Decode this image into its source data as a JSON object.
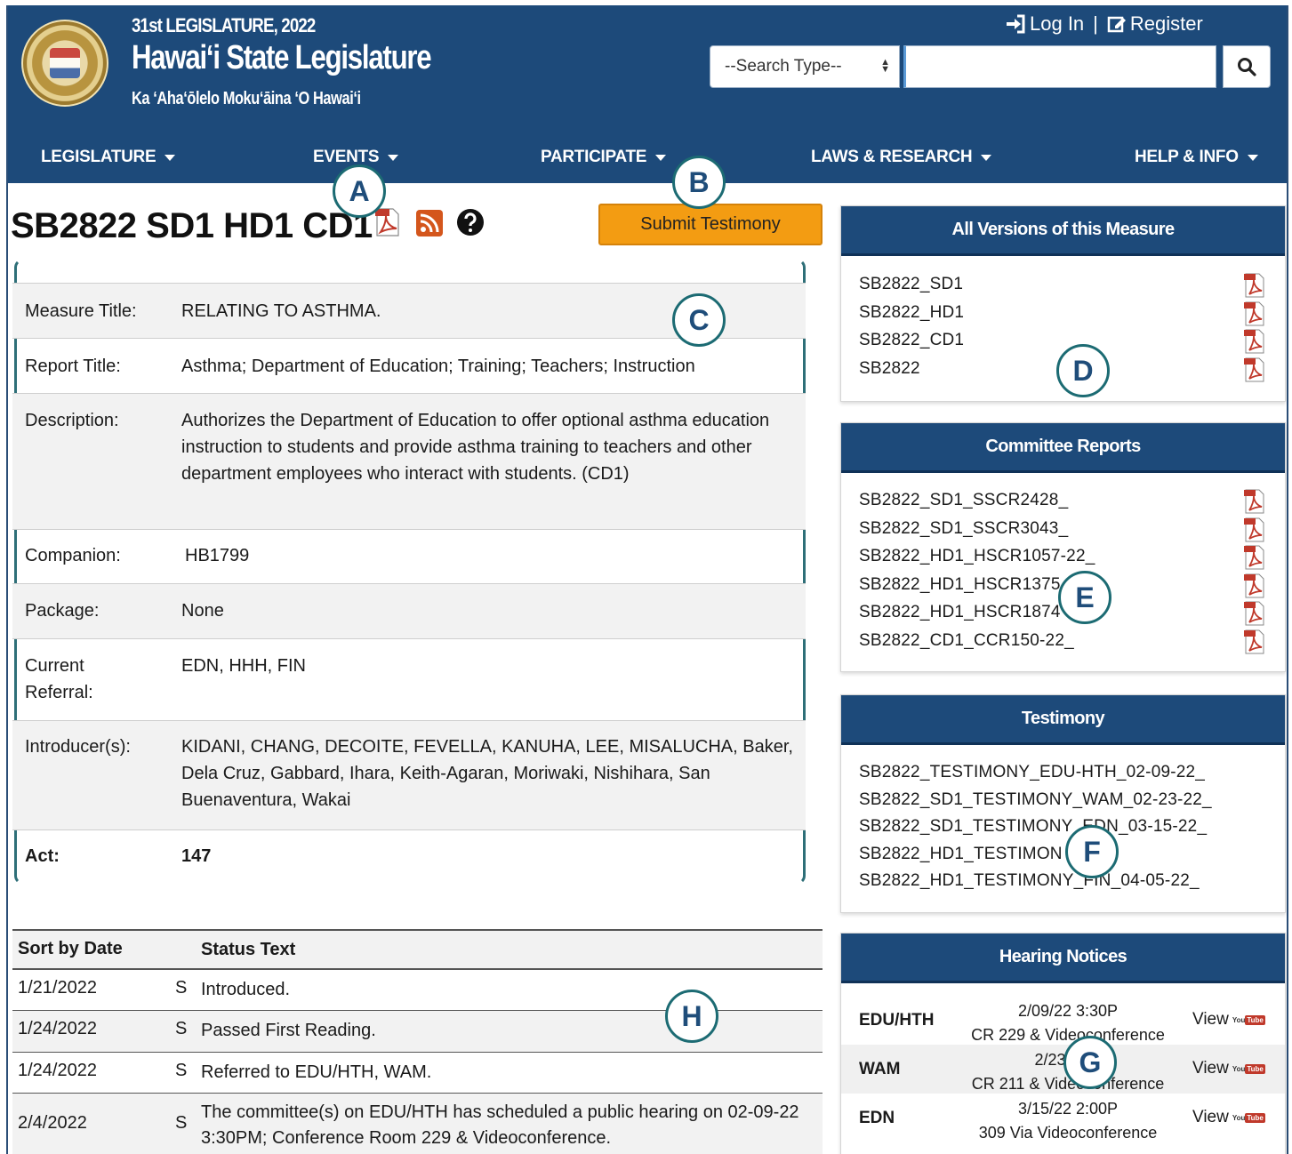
{
  "header": {
    "session": "31st LEGISLATURE, 2022",
    "title": "Hawai‘i State Legislature",
    "subtitle": "Ka ‘Aha‘ōlelo Moku‘āina ‘O Hawai‘i",
    "login": "Log In",
    "separator": "|",
    "register": "Register",
    "search_type": "--Search Type--",
    "search_value": ""
  },
  "nav": [
    "LEGISLATURE",
    "EVENTS",
    "PARTICIPATE",
    "LAWS & RESEARCH",
    "HELP & INFO"
  ],
  "markers": [
    "A",
    "B",
    "C",
    "D",
    "E",
    "F",
    "G",
    "H"
  ],
  "measure": {
    "title": "SB2822 SD1 HD1 CD1",
    "submit_label": "Submit Testimony"
  },
  "details": [
    {
      "label": "Measure Title:",
      "value": "RELATING TO ASTHMA."
    },
    {
      "label": "Report Title:",
      "value": "Asthma; Department of Education; Training; Teachers; Instruction"
    },
    {
      "label": "Description:",
      "value": "Authorizes the Department of Education to offer optional asthma education instruction to students and provide asthma training to teachers and other department employees who interact with students. (CD1)"
    },
    {
      "label": "Companion:",
      "value": " HB1799"
    },
    {
      "label": "Package:",
      "value": "None"
    },
    {
      "label": "Current Referral:",
      "value": "EDN, HHH, FIN"
    },
    {
      "label": "Introducer(s):",
      "value": "KIDANI, CHANG, DECOITE, FEVELLA, KANUHA, LEE, MISALUCHA, Baker, Dela Cruz, Gabbard, Ihara, Keith-Agaran, Moriwaki, Nishihara, San Buenaventura, Wakai"
    },
    {
      "label": "Act:",
      "value": "147"
    }
  ],
  "status_table": {
    "headers": [
      "Sort by Date",
      "Status Text"
    ],
    "rows": [
      {
        "date": "1/21/2022",
        "chamber": "S",
        "text": "Introduced."
      },
      {
        "date": "1/24/2022",
        "chamber": "S",
        "text": "Passed First Reading."
      },
      {
        "date": "1/24/2022",
        "chamber": "S",
        "text": "Referred to EDU/HTH, WAM."
      },
      {
        "date": "2/4/2022",
        "chamber": "S",
        "text": "The committee(s) on EDU/HTH has scheduled a public hearing on 02-09-22 3:30PM; Conference Room 229 & Videoconference."
      }
    ]
  },
  "versions": {
    "title": "All Versions of this Measure",
    "items": [
      "SB2822_SD1",
      "SB2822_HD1",
      "SB2822_CD1",
      "SB2822"
    ]
  },
  "committee_reports": {
    "title": "Committee Reports",
    "items": [
      "SB2822_SD1_SSCR2428_",
      "SB2822_SD1_SSCR3043_",
      "SB2822_HD1_HSCR1057-22_",
      "SB2822_HD1_HSCR1375",
      "SB2822_HD1_HSCR1874",
      "SB2822_CD1_CCR150-22_"
    ]
  },
  "testimony": {
    "title": "Testimony",
    "items": [
      "SB2822_TESTIMONY_EDU-HTH_02-09-22_",
      "SB2822_SD1_TESTIMONY_WAM_02-23-22_",
      "SB2822_SD1_TESTIMONY_EDN_03-15-22_",
      "SB2822_HD1_TESTIMON",
      "SB2822_HD1_TESTIMONY_FIN_04-05-22_"
    ]
  },
  "hearing_notices": {
    "title": "Hearing Notices",
    "view_label": "View",
    "rows": [
      {
        "committee": "EDU/HTH",
        "date": "2/09/22 3:30P",
        "room": "CR 229 & Videoconference"
      },
      {
        "committee": "WAM",
        "date": "2/23/22 1",
        "room": "CR 211 & Videoconference"
      },
      {
        "committee": "EDN",
        "date": "3/15/22 2:00P",
        "room": "309 Via Videoconference"
      }
    ]
  },
  "colors": {
    "header_blue": "#1d4a7a",
    "button_orange": "#f39c12",
    "marker_teal": "#1c6b73"
  }
}
